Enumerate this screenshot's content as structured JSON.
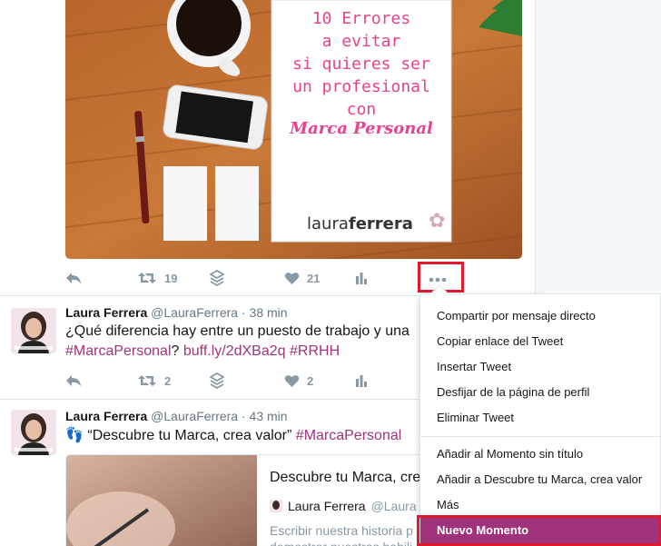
{
  "colors": {
    "accent": "#a0337b",
    "highlight": "#e0192e",
    "muted": "#8899a6"
  },
  "photo": {
    "lines": [
      "10 Errores",
      "a evitar",
      "si quieres ser",
      "un profesional",
      "con"
    ],
    "script_line": "Marca Personal",
    "logo_light": "laura",
    "logo_bold": "ferrera"
  },
  "tweet0": {
    "retweets": "19",
    "likes": "21"
  },
  "tweet1": {
    "fullname": "Laura Ferrera",
    "handle": "@LauraFerrera",
    "dot": "·",
    "time": "38 min",
    "text": "¿Qué diferencia hay entre un puesto de trabajo y una",
    "hashtag1": "#MarcaPersonal",
    "q": "?",
    "link": "buff.ly/2dXBa2q",
    "hashtag2": "#RRHH",
    "retweets": "2",
    "likes": "2"
  },
  "tweet2": {
    "fullname": "Laura Ferrera",
    "handle": "@LauraFerrera",
    "dot": "·",
    "time": "43 min",
    "text": "“Descubre tu Marca, crea valor”",
    "hashtag": "#MarcaPersonal",
    "card_title": "Descubre tu Marca, crea",
    "card_author": "Laura Ferrera",
    "card_handle": "@Laura",
    "card_desc1": "Escribir nuestra historia p",
    "card_desc2": "demostrar nuestras habili"
  },
  "menu": {
    "items": [
      "Compartir por mensaje directo",
      "Copiar enlace del Tweet",
      "Insertar Tweet",
      "Desfijar de la página de perfil",
      "Eliminar Tweet",
      "Añadir al Momento sin título",
      "Añadir a Descubre tu Marca, crea valor",
      "Más",
      "Nuevo Momento"
    ]
  },
  "icons": [
    "reply-icon",
    "retweet-icon",
    "layers-icon",
    "heart-icon",
    "analytics-icon",
    "more-icon"
  ]
}
